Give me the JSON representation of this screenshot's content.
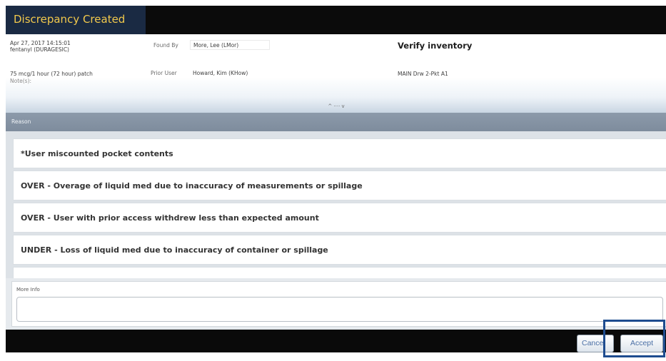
{
  "window": {
    "title": "Discrepancy Created"
  },
  "details": {
    "datetime": "Apr 27, 2017 14:15:01",
    "medication": "fentanyl (DURAGESIC)",
    "dose": "75 mcg/1 hour (72 hour) patch",
    "notes_label": "Note(s):",
    "found_by_label": "Found By",
    "found_by_value": "More, Lee (LMor)",
    "prior_user_label": "Prior User",
    "prior_user_value": "Howard, Kim (KHow)",
    "task_title": "Verify inventory",
    "location": "MAIN Drw 2-Pkt A1",
    "collapse_toggle": "^ ···· v"
  },
  "reason_section": {
    "label": "Reason",
    "items": [
      "*User miscounted pocket contents",
      "OVER - Overage of liquid med due to inaccuracy of measurements or spillage",
      "OVER - User with prior access withdrew less than expected amount",
      "UNDER - Loss of liquid med due to inaccuracy of container or spillage"
    ]
  },
  "more_info": {
    "label": "More Info",
    "value": ""
  },
  "footer": {
    "cancel_label": "Cancel",
    "accept_label": "Accept"
  },
  "colors": {
    "title": "#f2c94c",
    "title_tab": "#1a2a43",
    "highlight": "#1e4c8f"
  }
}
